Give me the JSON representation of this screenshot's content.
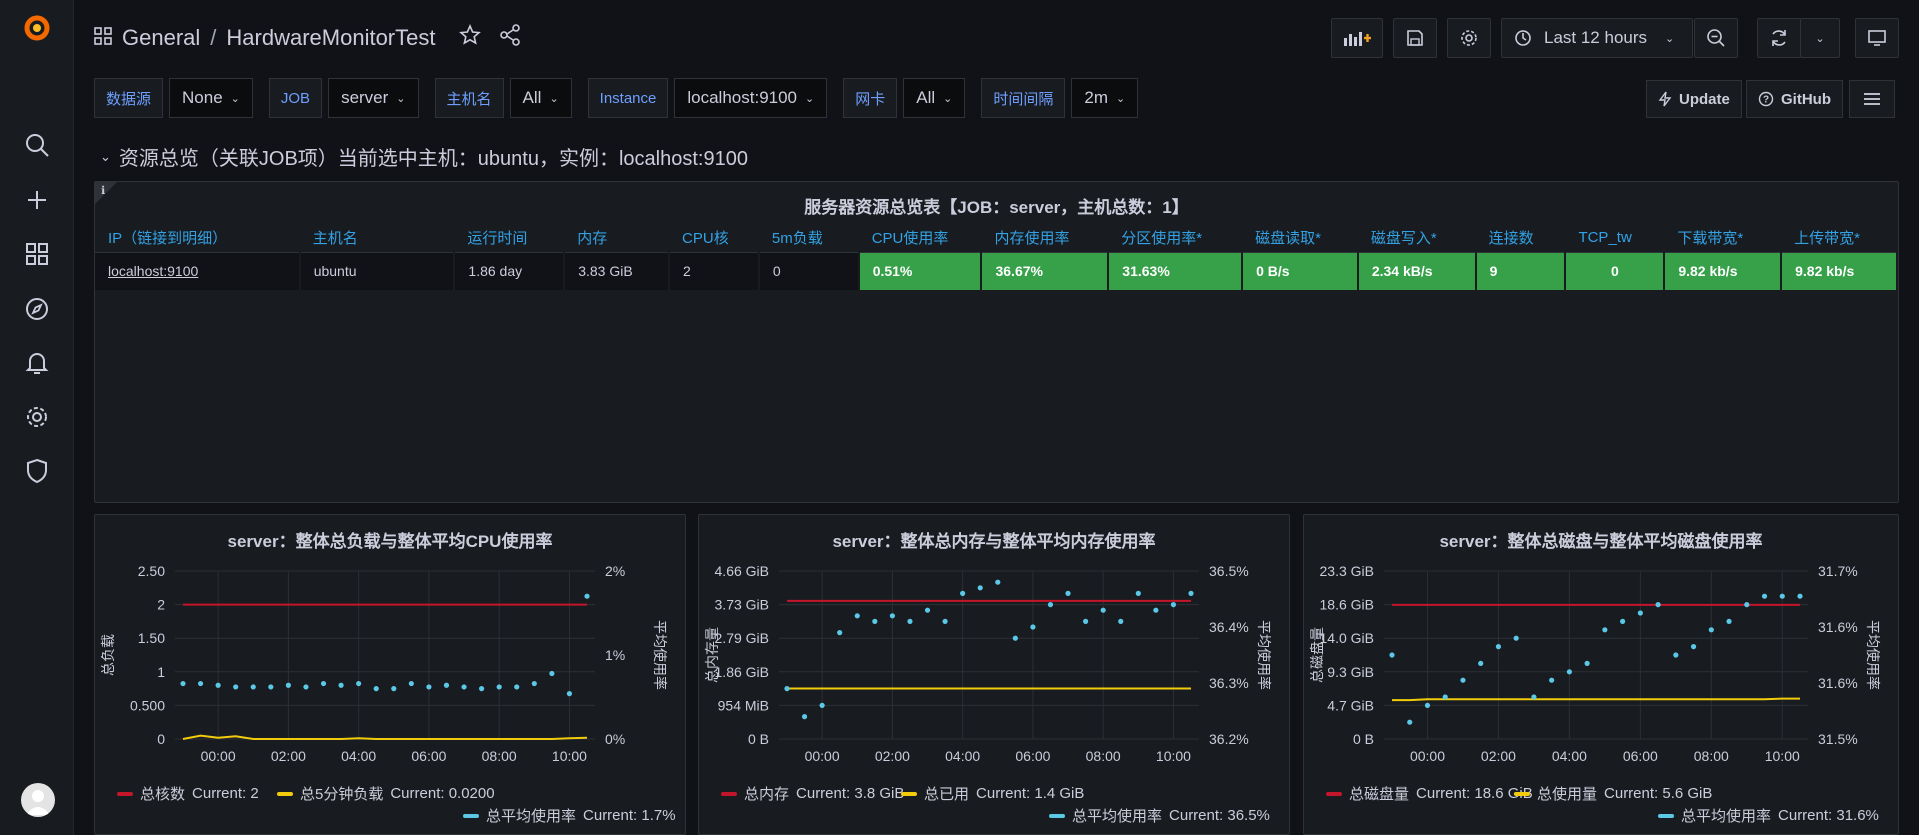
{
  "breadcrumb": {
    "folder": "General",
    "separator": "/",
    "dashboard": "HardwareMonitorTest"
  },
  "time_picker": {
    "label": "Last 12 hours"
  },
  "variables": [
    {
      "label": "数据源",
      "value": "None"
    },
    {
      "label": "JOB",
      "value": "server"
    },
    {
      "label": "主机名",
      "value": "All"
    },
    {
      "label": "Instance",
      "value": "localhost:9100"
    },
    {
      "label": "网卡",
      "value": "All"
    },
    {
      "label": "时间间隔",
      "value": "2m"
    }
  ],
  "links": {
    "update": "Update",
    "github": "GitHub"
  },
  "row_title": "资源总览（关联JOB项）当前选中主机：ubuntu，实例：localhost:9100",
  "overview": {
    "title": "服务器资源总览表【JOB：server，主机总数：1】",
    "columns": [
      "IP（链接到明细）",
      "主机名",
      "运行时间",
      "内存",
      "CPU核",
      "5m负载",
      "CPU使用率",
      "内存使用率",
      "分区使用率*",
      "磁盘读取*",
      "磁盘写入*",
      "连接数",
      "TCP_tw",
      "下载带宽*",
      "上传带宽*"
    ],
    "rows": [
      [
        "localhost:9100",
        "ubuntu",
        "1.86 day",
        "3.83 GiB",
        "2",
        "0",
        "0.51%",
        "36.67%",
        "31.63%",
        "0 B/s",
        "2.34 kB/s",
        "9",
        "0",
        "9.82 kb/s",
        "9.82 kb/s"
      ]
    ],
    "colors": {
      "ok": "#37a14a"
    }
  },
  "colors": {
    "red": "#c4162a",
    "yellow": "#f2cc0c",
    "cyan": "#5ac8e6",
    "grid": "#2c3035"
  },
  "charts": [
    {
      "title": "server：整体总负载与整体平均CPU使用率",
      "y_left_label": "总负载",
      "y_right_label": "平均使用率",
      "y_left_ticks": [
        "2.50",
        "2",
        "1.50",
        "1",
        "0.500",
        "0"
      ],
      "y_right_ticks": [
        "2%",
        "1%",
        "0%"
      ],
      "x_ticks": [
        "00:00",
        "02:00",
        "04:00",
        "06:00",
        "08:00",
        "10:00"
      ],
      "legend": [
        {
          "name": "总核数",
          "current": "Current: 2",
          "color": "#c4162a"
        },
        {
          "name": "总5分钟负载",
          "current": "Current: 0.0200",
          "color": "#f2cc0c"
        },
        {
          "name": "总平均使用率",
          "current": "Current: 1.7%",
          "color": "#5ac8e6"
        }
      ]
    },
    {
      "title": "server：整体总内存与整体平均内存使用率",
      "y_left_label": "总内存量",
      "y_right_label": "平均使用率",
      "y_left_ticks": [
        "4.66 GiB",
        "3.73 GiB",
        "2.79 GiB",
        "1.86 GiB",
        "954 MiB",
        "0 B"
      ],
      "y_right_ticks": [
        "36.5%",
        "36.4%",
        "36.3%",
        "36.2%"
      ],
      "x_ticks": [
        "00:00",
        "02:00",
        "04:00",
        "06:00",
        "08:00",
        "10:00"
      ],
      "legend": [
        {
          "name": "总内存",
          "current": "Current: 3.8 GiB",
          "color": "#c4162a"
        },
        {
          "name": "总已用",
          "current": "Current: 1.4 GiB",
          "color": "#f2cc0c"
        },
        {
          "name": "总平均使用率",
          "current": "Current: 36.5%",
          "color": "#5ac8e6"
        }
      ]
    },
    {
      "title": "server：整体总磁盘与整体平均磁盘使用率",
      "y_left_label": "总磁盘量",
      "y_right_label": "平均使用率",
      "y_left_ticks": [
        "23.3 GiB",
        "18.6 GiB",
        "14.0 GiB",
        "9.3 GiB",
        "4.7 GiB",
        "0 B"
      ],
      "y_right_ticks": [
        "31.7%",
        "31.6%",
        "31.6%",
        "31.5%"
      ],
      "x_ticks": [
        "00:00",
        "02:00",
        "04:00",
        "06:00",
        "08:00",
        "10:00"
      ],
      "legend": [
        {
          "name": "总磁盘量",
          "current": "Current: 18.6 GiB",
          "color": "#c4162a"
        },
        {
          "name": "总使用量",
          "current": "Current: 5.6 GiB",
          "color": "#f2cc0c"
        },
        {
          "name": "总平均使用率",
          "current": "Current: 31.6%",
          "color": "#5ac8e6"
        }
      ]
    }
  ],
  "chart_data": [
    {
      "type": "line",
      "title": "server：整体总负载与整体平均CPU使用率",
      "x": [
        "23:00",
        "23:30",
        "00:00",
        "00:30",
        "01:00",
        "01:30",
        "02:00",
        "02:30",
        "03:00",
        "03:30",
        "04:00",
        "04:30",
        "05:00",
        "05:30",
        "06:00",
        "06:30",
        "07:00",
        "07:30",
        "08:00",
        "08:30",
        "09:00",
        "09:30",
        "10:00",
        "10:30"
      ],
      "ylabel": "总负载",
      "ylim": [
        0,
        2.5
      ],
      "y2label": "平均使用率",
      "y2lim": [
        0,
        2
      ],
      "series": [
        {
          "name": "总核数",
          "axis": "left",
          "values": [
            2,
            2,
            2,
            2,
            2,
            2,
            2,
            2,
            2,
            2,
            2,
            2,
            2,
            2,
            2,
            2,
            2,
            2,
            2,
            2,
            2,
            2,
            2,
            2
          ]
        },
        {
          "name": "总5分钟负载",
          "axis": "left",
          "values": [
            0,
            0.05,
            0.02,
            0.04,
            0,
            0,
            0,
            0,
            0,
            0,
            0.01,
            0,
            0,
            0,
            0,
            0,
            0,
            0,
            0,
            0,
            0,
            0,
            0.01,
            0.02
          ]
        },
        {
          "name": "总平均使用率",
          "axis": "right",
          "values": [
            0.66,
            0.66,
            0.64,
            0.62,
            0.62,
            0.62,
            0.64,
            0.62,
            0.66,
            0.64,
            0.66,
            0.6,
            0.6,
            0.66,
            0.62,
            0.64,
            0.62,
            0.6,
            0.62,
            0.62,
            0.66,
            0.78,
            0.54,
            1.7
          ]
        }
      ]
    },
    {
      "type": "line",
      "title": "server：整体总内存与整体平均内存使用率",
      "x": [
        "23:00",
        "23:30",
        "00:00",
        "00:30",
        "01:00",
        "01:30",
        "02:00",
        "02:30",
        "03:00",
        "03:30",
        "04:00",
        "04:30",
        "05:00",
        "05:30",
        "06:00",
        "06:30",
        "07:00",
        "07:30",
        "08:00",
        "08:30",
        "09:00",
        "09:30",
        "10:00",
        "10:30"
      ],
      "ylabel": "总内存量",
      "ylim": [
        0,
        4.66
      ],
      "y2label": "平均使用率",
      "y2lim": [
        36.2,
        36.5
      ],
      "series": [
        {
          "name": "总内存",
          "axis": "left",
          "values": [
            3.83,
            3.83,
            3.83,
            3.83,
            3.83,
            3.83,
            3.83,
            3.83,
            3.83,
            3.83,
            3.83,
            3.83,
            3.83,
            3.83,
            3.83,
            3.83,
            3.83,
            3.83,
            3.83,
            3.83,
            3.83,
            3.83,
            3.83,
            3.83
          ]
        },
        {
          "name": "总已用",
          "axis": "left",
          "values": [
            1.4,
            1.4,
            1.4,
            1.4,
            1.4,
            1.4,
            1.4,
            1.4,
            1.4,
            1.4,
            1.4,
            1.4,
            1.4,
            1.4,
            1.4,
            1.4,
            1.4,
            1.4,
            1.4,
            1.4,
            1.4,
            1.4,
            1.4,
            1.4
          ]
        },
        {
          "name": "总平均使用率",
          "axis": "right",
          "values": [
            36.29,
            36.24,
            36.26,
            36.39,
            36.42,
            36.41,
            36.42,
            36.41,
            36.43,
            36.41,
            36.46,
            36.47,
            36.48,
            36.38,
            36.4,
            36.44,
            36.46,
            36.41,
            36.43,
            36.41,
            36.46,
            36.43,
            36.44,
            36.46
          ]
        }
      ]
    },
    {
      "type": "line",
      "title": "server：整体总磁盘与整体平均磁盘使用率",
      "x": [
        "23:00",
        "23:30",
        "00:00",
        "00:30",
        "01:00",
        "01:30",
        "02:00",
        "02:30",
        "03:00",
        "03:30",
        "04:00",
        "04:30",
        "05:00",
        "05:30",
        "06:00",
        "06:30",
        "07:00",
        "07:30",
        "08:00",
        "08:30",
        "09:00",
        "09:30",
        "10:00",
        "10:30"
      ],
      "ylabel": "总磁盘量",
      "ylim": [
        0,
        23.3
      ],
      "y2label": "平均使用率",
      "y2lim": [
        31.5,
        31.7
      ],
      "series": [
        {
          "name": "总磁盘量",
          "axis": "left",
          "values": [
            18.6,
            18.6,
            18.6,
            18.6,
            18.6,
            18.6,
            18.6,
            18.6,
            18.6,
            18.6,
            18.6,
            18.6,
            18.6,
            18.6,
            18.6,
            18.6,
            18.6,
            18.6,
            18.6,
            18.6,
            18.6,
            18.6,
            18.6,
            18.6
          ]
        },
        {
          "name": "总使用量",
          "axis": "left",
          "values": [
            5.4,
            5.4,
            5.5,
            5.5,
            5.5,
            5.5,
            5.5,
            5.5,
            5.5,
            5.5,
            5.5,
            5.5,
            5.5,
            5.5,
            5.5,
            5.5,
            5.5,
            5.5,
            5.5,
            5.5,
            5.5,
            5.5,
            5.6,
            5.6
          ]
        },
        {
          "name": "总平均使用率",
          "axis": "right",
          "values": [
            31.6,
            31.52,
            31.54,
            31.55,
            31.57,
            31.59,
            31.61,
            31.62,
            31.55,
            31.57,
            31.58,
            31.59,
            31.63,
            31.64,
            31.65,
            31.66,
            31.6,
            31.61,
            31.63,
            31.64,
            31.66,
            31.67,
            31.67,
            31.67
          ]
        }
      ]
    }
  ]
}
